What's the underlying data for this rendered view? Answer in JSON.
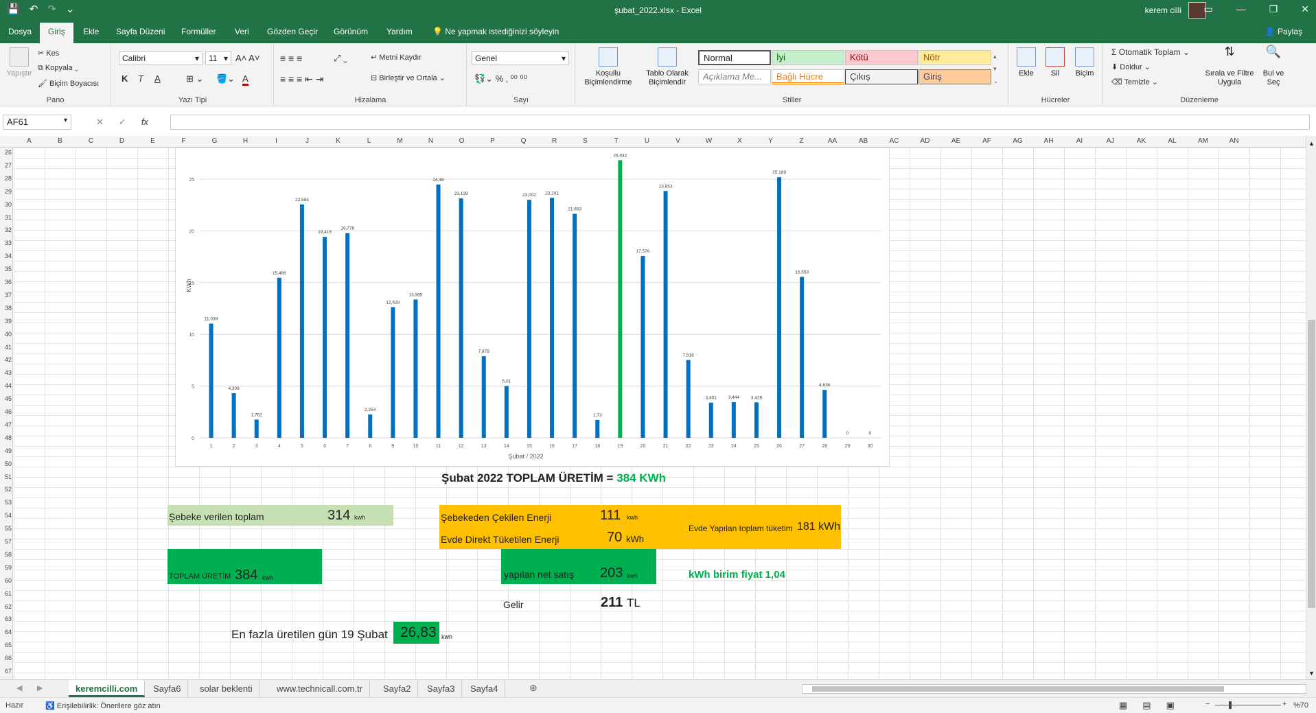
{
  "title_bar": {
    "doc_title": "şubat_2022.xlsx  -  Excel",
    "user_name": "kerem cilli"
  },
  "menu": {
    "tabs": [
      "Dosya",
      "Giriş",
      "Ekle",
      "Sayfa Düzeni",
      "Formüller",
      "Veri",
      "Gözden Geçir",
      "Görünüm",
      "Yardım"
    ],
    "active_tab": "Giriş",
    "tell_me": "Ne yapmak istediğinizi söyleyin",
    "share": "Paylaş"
  },
  "ribbon": {
    "pano": {
      "label": "Pano",
      "paste": "Yapıştır",
      "cut": "Kes",
      "copy": "Kopyala",
      "format_painter": "Biçim Boyacısı"
    },
    "font": {
      "label": "Yazı Tipi",
      "name": "Calibri",
      "size": "11",
      "bold": "K",
      "italic": "T",
      "underline": "A"
    },
    "alignment": {
      "label": "Hizalama",
      "wrap": "Metni Kaydır",
      "merge": "Birleştir ve Ortala"
    },
    "number": {
      "label": "Sayı",
      "format": "Genel"
    },
    "styles": {
      "label": "Stiller",
      "conditional": "Koşullu Biçimlendirme",
      "as_table": "Tablo Olarak Biçimlendir",
      "cells": [
        "Normal",
        "İyi",
        "Kötü",
        "Nötr",
        "Açıklama Me...",
        "Bağlı Hücre",
        "Çıkış",
        "Giriş"
      ]
    },
    "cells": {
      "label": "Hücreler",
      "insert": "Ekle",
      "delete": "Sil",
      "format": "Biçim"
    },
    "editing": {
      "label": "Düzenleme",
      "autosum": "Otomatik Toplam",
      "fill": "Doldur",
      "clear": "Temizle",
      "sort": "Sırala ve Filtre Uygula",
      "find": "Bul ve Seç"
    }
  },
  "formula_bar": {
    "name_box": "AF61",
    "fx": "fx",
    "formula": ""
  },
  "columns": [
    "A",
    "B",
    "C",
    "D",
    "E",
    "F",
    "G",
    "H",
    "I",
    "J",
    "K",
    "L",
    "M",
    "N",
    "O",
    "P",
    "Q",
    "R",
    "S",
    "T",
    "U",
    "V",
    "W",
    "X",
    "Y",
    "Z",
    "AA",
    "AB",
    "AC",
    "AD",
    "AE",
    "AF",
    "AG",
    "AH",
    "AI",
    "AJ",
    "AK",
    "AL",
    "AM",
    "AN"
  ],
  "rows": [
    "26",
    "27",
    "28",
    "29",
    "30",
    "31",
    "32",
    "33",
    "34",
    "35",
    "36",
    "37",
    "38",
    "39",
    "40",
    "41",
    "42",
    "43",
    "44",
    "45",
    "46",
    "47",
    "48",
    "49",
    "50",
    "51",
    "52",
    "53",
    "54",
    "55",
    "57",
    "58",
    "59",
    "60",
    "61",
    "62",
    "63",
    "64",
    "65",
    "66",
    "67"
  ],
  "chart_data": {
    "type": "bar",
    "categories": [
      "1",
      "2",
      "3",
      "4",
      "5",
      "6",
      "7",
      "8",
      "9",
      "10",
      "11",
      "12",
      "13",
      "14",
      "15",
      "16",
      "17",
      "18",
      "19",
      "20",
      "21",
      "22",
      "23",
      "24",
      "25",
      "26",
      "27",
      "28",
      "29",
      "30"
    ],
    "values": [
      11.038,
      4.309,
      1.762,
      15.466,
      22.555,
      19.415,
      19.778,
      2.254,
      12.628,
      13.365,
      24.48,
      23.139,
      7.879,
      5.01,
      23.002,
      23.191,
      21.653,
      1.73,
      26.832,
      17.576,
      23.853,
      7.518,
      3.401,
      3.444,
      3.428,
      25.189,
      15.553,
      4.636,
      0,
      0
    ],
    "data_labels": [
      "11,038",
      "4,309",
      "1,762",
      "15,466",
      "22,555",
      "19,415",
      "19,778",
      "2,254",
      "12,628",
      "13,365",
      "24,48",
      "23,139",
      "7,879",
      "5,01",
      "23,002",
      "23,191",
      "21,653",
      "1,73",
      "26,832",
      "17,576",
      "23,853",
      "7,518",
      "3,401",
      "3,444",
      "3,428",
      "25,189",
      "15,553",
      "4,636",
      "0",
      "0"
    ],
    "highlight_index": 18,
    "bar_color": "#0070c0",
    "highlight_color": "#00b050",
    "xlabel": "Şubat / 2022",
    "ylabel": "KWh",
    "ylim": [
      0,
      25
    ],
    "yticks": [
      0,
      5,
      10,
      15,
      20,
      25
    ],
    "grid": true
  },
  "summary": {
    "title_prefix": "Şubat 2022 TOPLAM ÜRETİM = ",
    "title_value": "384 KWh",
    "grid_given_label": "Şebeke verilen toplam",
    "grid_given_value": "314",
    "drawn_label": "Şebekeden Çekilen Enerji",
    "drawn_value": "111",
    "direct_label": "Evde Direkt Tüketilen Enerji",
    "direct_value": "70",
    "home_total_label": "Evde Yapılan toplam tüketim",
    "home_total_value": "181 kWh",
    "total_prod_label": "TOPLAM ÜRETİM",
    "total_prod_value": "384",
    "net_sale_label": "yapılan net satış",
    "net_sale_value": "203",
    "unit_price": "kWh birim fiyat 1,04",
    "income_label": "Gelir",
    "income_value": "211",
    "income_unit": "TL",
    "max_day_label": "En fazla üretilen gün 19 Şubat",
    "max_day_value": "26,83",
    "unit_kwh_small": "kwh",
    "unit_kwh": "kWh"
  },
  "sheet_tabs": [
    "keremcilli.com",
    "Sayfa6",
    "solar beklenti",
    "www.technicall.com.tr",
    "Sayfa2",
    "Sayfa3",
    "Sayfa4"
  ],
  "active_sheet": "keremcilli.com",
  "status": {
    "ready": "Hazır",
    "accessibility": "Erişilebilirlik: Önerilere göz atın",
    "zoom": "%70"
  },
  "colors": {
    "excel_green": "#217346",
    "light_green": "#c6e0b4",
    "bright_green": "#00b050",
    "orange": "#ffc000"
  }
}
